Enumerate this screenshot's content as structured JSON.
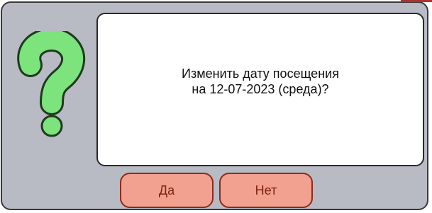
{
  "dialog": {
    "icon": "question-mark-icon",
    "message": {
      "line1": "Изменить дату посещения",
      "line2": "на 12-07-2023 (среда)?"
    },
    "buttons": {
      "yes_label": "Да",
      "no_label": "Нет"
    }
  },
  "colors": {
    "frame_background": "#b8bac4",
    "icon_fill": "#7de37d",
    "button_fill": "#f2a190",
    "button_text": "#7a2410"
  }
}
